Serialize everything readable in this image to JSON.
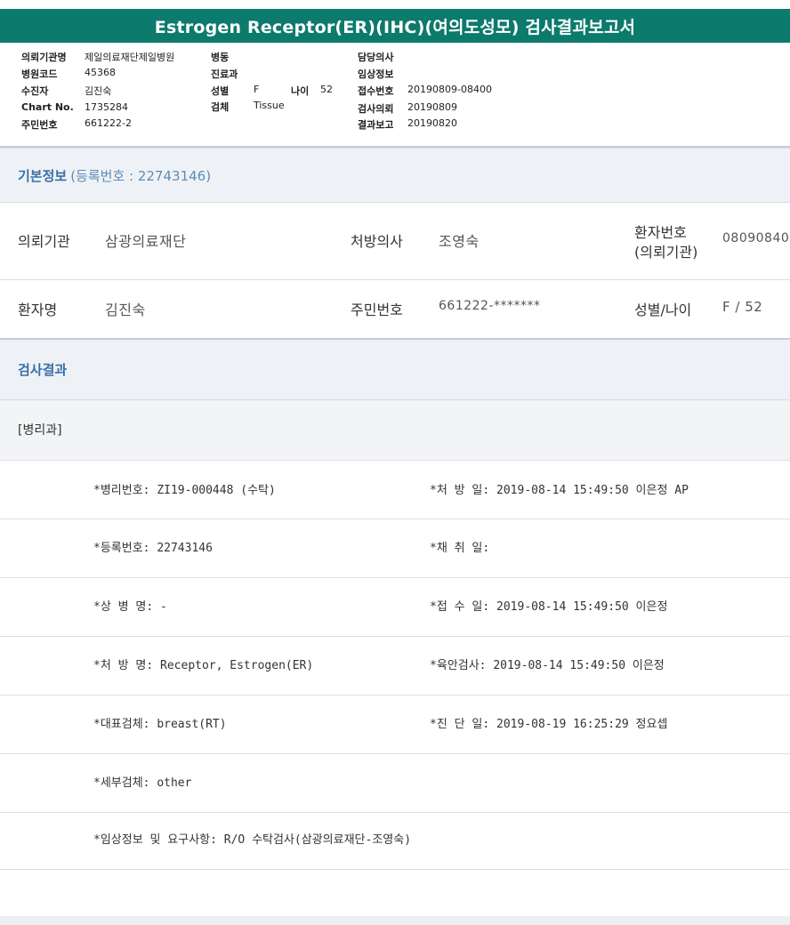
{
  "title": "Estrogen Receptor(ER)(IHC)(여의도성모) 검사결과보고서",
  "header_info": {
    "col1": [
      {
        "label": "의뢰기관명",
        "value": "제일의료재단제일병원"
      },
      {
        "label": "병원코드",
        "value": "45368"
      },
      {
        "label": "수진자",
        "value": "김진숙"
      },
      {
        "label": "Chart No.",
        "value": "1735284"
      },
      {
        "label": "주민번호",
        "value": "661222-2"
      }
    ],
    "col2": [
      {
        "label": "병동",
        "value": ""
      },
      {
        "label": "진료과",
        "value": ""
      },
      {
        "label": "성별",
        "value": "F"
      },
      {
        "label": "검체",
        "value": "Tissue"
      }
    ],
    "age": {
      "label": "나이",
      "value": "52"
    },
    "col3": [
      {
        "label": "담당의사",
        "value": ""
      },
      {
        "label": "임상정보",
        "value": ""
      },
      {
        "label": "접수번호",
        "value": "20190809-08400"
      },
      {
        "label": "검사의뢰",
        "value": "20190809"
      },
      {
        "label": "결과보고",
        "value": "20190820"
      }
    ]
  },
  "basic_info": {
    "heading": "기본정보",
    "reg_label": "(등록번호 : 22743146)",
    "row1": {
      "k1": "의뢰기관",
      "v1": "삼광의료재단",
      "k2": "처방의사",
      "v2": "조영숙",
      "k3a": "환자번호",
      "k3b": "(의뢰기관)",
      "v3": "08090840"
    },
    "row2": {
      "k1": "환자명",
      "v1": "김진숙",
      "k2": "주민번호",
      "v2": "661222-*******",
      "k3": "성별/나이",
      "v3": "F / 52"
    }
  },
  "results": {
    "heading": "검사결과",
    "dept": "[병리과]",
    "rows": [
      {
        "left": "*병리번호: ZI19-000448 (수탁)",
        "right": "*처 방 일: 2019-08-14 15:49:50  이은정 AP"
      },
      {
        "left": "*등록번호: 22743146",
        "right": "*채 취 일:"
      },
      {
        "left": "*상 병 명: -",
        "right": "*접 수 일: 2019-08-14 15:49:50  이은정"
      },
      {
        "left": "*처 방 명: Receptor, Estrogen(ER)",
        "right": "*육안검사: 2019-08-14 15:49:50  이은정"
      },
      {
        "left": "*대표검체: breast(RT)",
        "right": "*진 단 일: 2019-08-19 16:25:29  정요셉"
      },
      {
        "left": "*세부검체: other",
        "right": ""
      },
      {
        "left": "*임상정보 및 요구사항: R/O 수탁검사(삼광의료재단-조영숙)",
        "right": ""
      }
    ]
  }
}
